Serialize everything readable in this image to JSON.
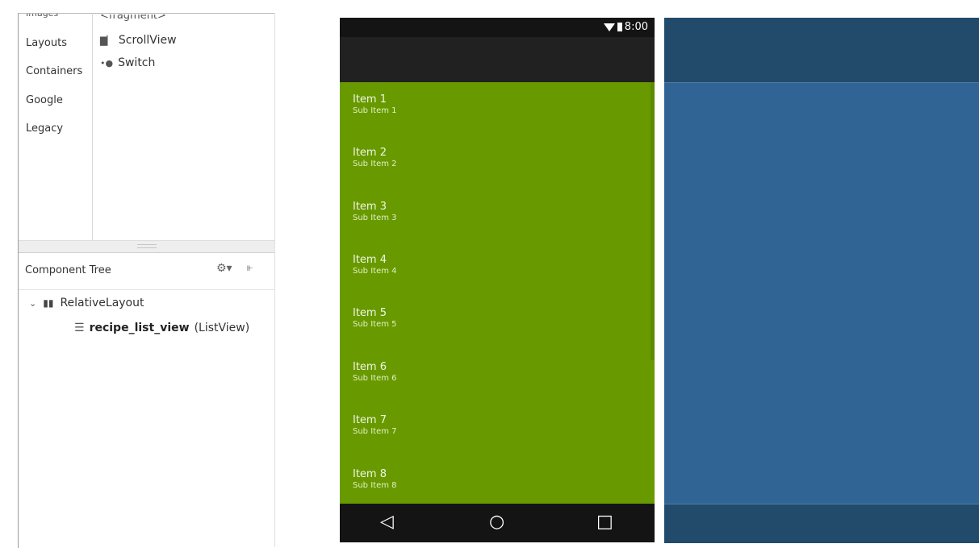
{
  "palette": {
    "categories": [
      "Layouts",
      "Containers",
      "Google",
      "Legacy"
    ],
    "widgets": [
      {
        "label": "ScrollView",
        "icon": "scrollview-icon"
      },
      {
        "label": "Switch",
        "icon": "switch-icon"
      }
    ],
    "cut_top_category": "Images",
    "cut_top_widget": "<fragment>"
  },
  "component_tree": {
    "title": "Component Tree",
    "root": {
      "label": "RelativeLayout",
      "icon": "relativelayout-icon"
    },
    "child": {
      "id": "recipe_list_view",
      "type": "(ListView)",
      "icon": "listview-icon"
    }
  },
  "phone": {
    "status_time": "8:00",
    "items": [
      {
        "title": "Item 1",
        "sub": "Sub Item 1"
      },
      {
        "title": "Item 2",
        "sub": "Sub Item 2"
      },
      {
        "title": "Item 3",
        "sub": "Sub Item 3"
      },
      {
        "title": "Item 4",
        "sub": "Sub Item 4"
      },
      {
        "title": "Item 5",
        "sub": "Sub Item 5"
      },
      {
        "title": "Item 6",
        "sub": "Sub Item 6"
      },
      {
        "title": "Item 7",
        "sub": "Sub Item 7"
      },
      {
        "title": "Item 8",
        "sub": "Sub Item 8"
      }
    ],
    "nav": {
      "back": "◁",
      "home": "○",
      "recents": "□"
    }
  },
  "colors": {
    "list_background": "#689a00",
    "blueprint": "#2f6494",
    "status_bar": "#141414"
  }
}
